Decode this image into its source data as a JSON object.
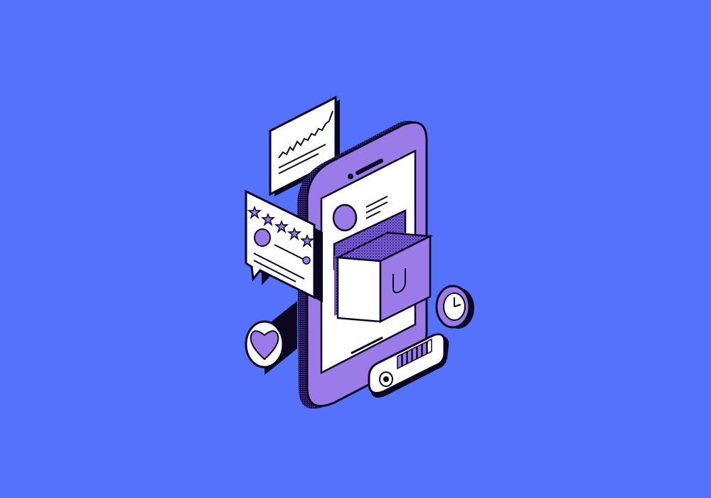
{
  "colors": {
    "background": "#5472fb",
    "purple": "#9b7be8",
    "deep_purple": "#7c5ee0",
    "outline": "#0b0720",
    "paper": "#ffffff"
  },
  "illustration": {
    "subject": "isometric-smartphone-shopping",
    "review_stars": 5,
    "battery_level": 0.8
  }
}
